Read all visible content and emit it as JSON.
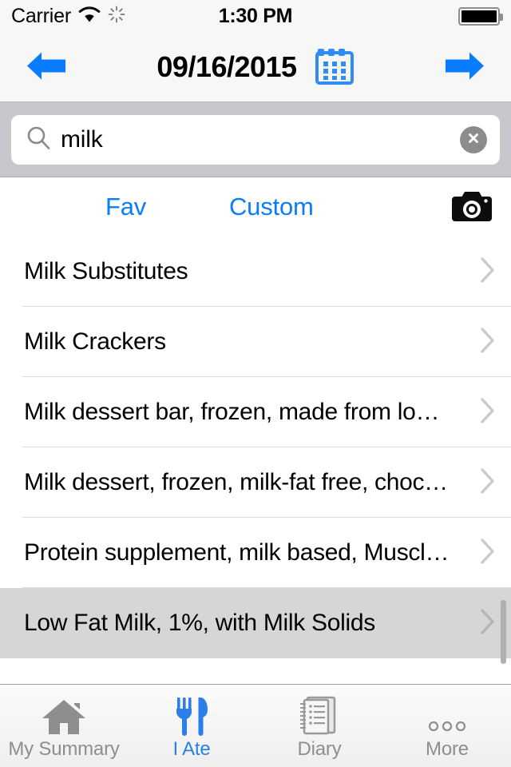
{
  "status_bar": {
    "carrier": "Carrier",
    "wifi_icon": "wifi-icon",
    "activity_icon": "network-activity-spinner-icon",
    "time": "1:30 PM",
    "battery_icon": "battery-full-icon"
  },
  "nav_bar": {
    "prev_icon": "left-arrow-icon",
    "date": "09/16/2015",
    "calendar_icon": "calendar-icon",
    "next_icon": "right-arrow-icon",
    "accent_color": "#0a7cff"
  },
  "search": {
    "icon": "search-icon",
    "value": "milk",
    "placeholder": "Search",
    "clear_icon": "clear-circle-icon"
  },
  "segment_row": {
    "fav_label": "Fav",
    "custom_label": "Custom",
    "camera_icon": "camera-icon"
  },
  "results": [
    {
      "label": "Milk Substitutes",
      "selected": false,
      "subtext": ""
    },
    {
      "label": "Milk Crackers",
      "selected": false,
      "subtext": ""
    },
    {
      "label": "Milk dessert bar, frozen, made from lo…",
      "selected": false,
      "subtext": ""
    },
    {
      "label": "Milk dessert, frozen, milk-fat free, choc…",
      "selected": false,
      "subtext": ""
    },
    {
      "label": "Protein supplement, milk based, Muscl…",
      "selected": false,
      "subtext": ""
    },
    {
      "label": "Low Fat Milk, 1%, with Milk Solids",
      "selected": true,
      "subtext": "·  ·"
    }
  ],
  "tab_bar": {
    "tabs": [
      {
        "label": "My Summary",
        "icon": "home-icon",
        "active": false
      },
      {
        "label": "I Ate",
        "icon": "fork-knife-icon",
        "active": true
      },
      {
        "label": "Diary",
        "icon": "notebook-icon",
        "active": false
      },
      {
        "label": "More",
        "icon": "ellipsis-icon",
        "active": false
      }
    ],
    "active_color": "#2b7fe8",
    "inactive_color": "#8e8e8e"
  }
}
